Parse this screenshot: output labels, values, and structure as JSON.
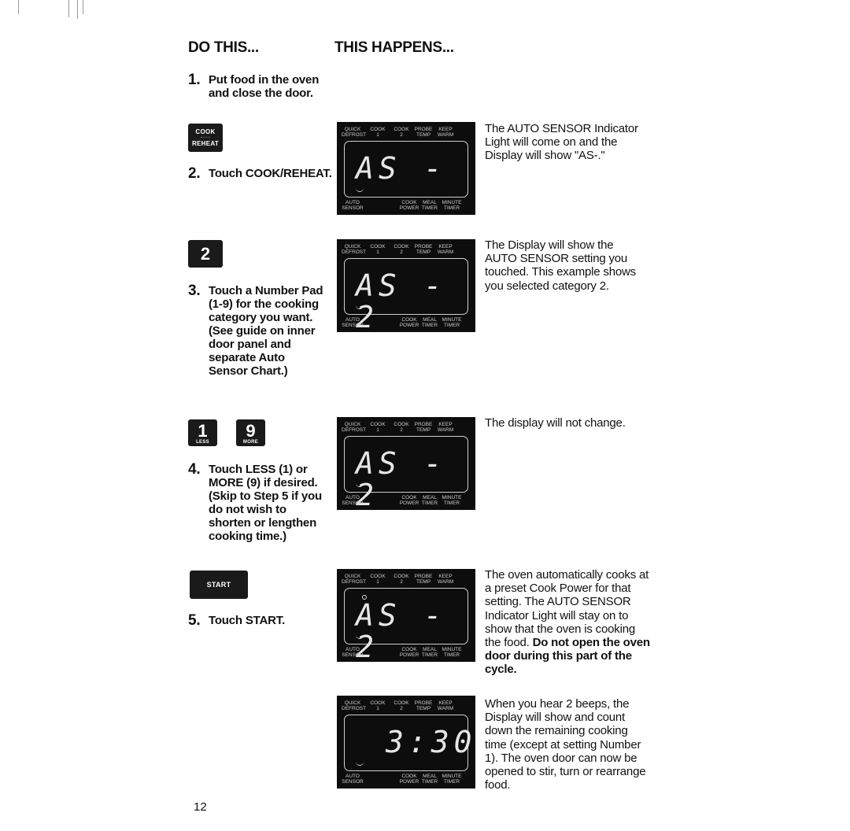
{
  "headers": {
    "do_this": "DO THIS...",
    "this_happens": "THIS HAPPENS..."
  },
  "panel_labels": {
    "top": [
      "QUICK\nDEFROST",
      "COOK\n1",
      "COOK\n2",
      "PROBE\nTEMP",
      "KEEP\nWARM"
    ],
    "bottom": [
      "AUTO\nSENSOR",
      "COOK\nPOWER",
      "MEAL\nTIMER",
      "MINUTE\nTIMER"
    ]
  },
  "steps": [
    {
      "num": "1.",
      "text": "Put food in the oven and close the door."
    },
    {
      "num": "2.",
      "text": "Touch COOK/REHEAT.",
      "key": {
        "top": "COOK",
        "bottom": "REHEAT"
      },
      "display": "AS -",
      "desc": "The AUTO SENSOR Indicator Light will come on and the Display will show \"AS-.\""
    },
    {
      "num": "3.",
      "text": "Touch a Number Pad (1-9) for the cooking category you want. (See guide on inner door panel and separate Auto Sensor Chart.)",
      "key": {
        "label": "2"
      },
      "display": "AS - 2",
      "desc": "The Display will show the AUTO SENSOR setting you touched. This example shows you selected category 2."
    },
    {
      "num": "4.",
      "text": "Touch LESS (1) or MORE (9) if desired. (Skip to Step 5 if you do not wish to shorten or lengthen cooking time.)",
      "keys": [
        {
          "label": "1",
          "sub": "LESS"
        },
        {
          "label": "9",
          "sub": "MORE"
        }
      ],
      "display": "AS - 2",
      "desc": "The display will not change."
    },
    {
      "num": "5.",
      "text": "Touch START.",
      "key": {
        "label": "START"
      },
      "display": "AS - 2",
      "desc_plain": "The oven automatically cooks at a preset Cook Power for that setting. The AUTO SENSOR Indicator Light will stay on to show that the oven is cooking the food.",
      "desc_bold": "Do not open the oven door during this part of the cycle."
    }
  ],
  "final": {
    "display": "3:30",
    "desc": "When you hear 2 beeps, the Display will show and count down the remaining cooking time (except at setting Number 1). The oven door can now be opened to stir, turn or rearrange food."
  },
  "page_number": "12"
}
